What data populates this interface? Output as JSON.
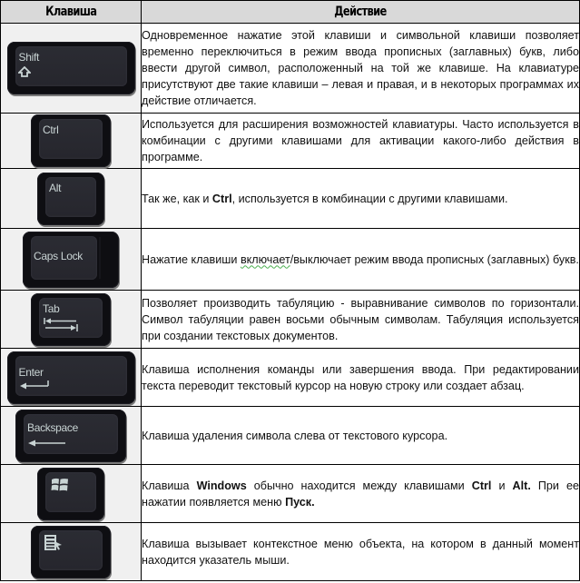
{
  "table": {
    "headers": {
      "key": "Клавиша",
      "action": "Действие"
    },
    "colors": {
      "header_bg": "#d9d9d9",
      "key_column_bg": "#f0f0f0",
      "keycap": "#0e0e12",
      "key_label": "#c9d4d4"
    },
    "rows": [
      {
        "key_label": "Shift",
        "key_icon": "shift-arrow-icon",
        "description": "Одновременное нажатие этой клавиши и символьной клавиши позволяет временно переключиться в режим ввода прописных (заглавных) букв, либо ввести другой символ, расположенный на той же клавише. На клавиатуре присутствуют две такие клавиши – левая и правая, и в некоторых программах их действие отличается."
      },
      {
        "key_label": "Ctrl",
        "description": "Используется для расширения возможностей клавиатуры. Часто используется в комбинации с другими клавишами для активации какого-либо действия в программе."
      },
      {
        "key_label": "Alt",
        "description_parts": [
          "Так же, как и ",
          "Ctrl",
          ", используется в комбинации с другими клавишами."
        ]
      },
      {
        "key_label": "Caps Lock",
        "description_parts": [
          "Нажатие клавиши ",
          "включает",
          "/выключает режим ввода прописных (заглавных) букв."
        ]
      },
      {
        "key_label": "Tab",
        "key_icon": "tab-arrows-icon",
        "description": "Позволяет производить табуляцию - выравнивание символов по горизонтали. Символ табуляции равен восьми обычным символам. Табуляция используется при создании текстовых документов."
      },
      {
        "key_label": "Enter",
        "key_icon": "enter-arrow-icon",
        "description": "Клавиша исполнения команды или завершения ввода. При редактировании текста переводит текстовый курсор на новую строку или создает абзац."
      },
      {
        "key_label": "Backspace",
        "key_icon": "backspace-arrow-icon",
        "description": "Клавиша удаления символа слева от текстового курсора."
      },
      {
        "key_label": "",
        "key_icon": "windows-logo-icon",
        "description_parts": [
          "Клавиша ",
          "Windows",
          " обычно находится между клавишами ",
          "Ctrl",
          " и ",
          "Alt.",
          " При ее нажатии появляется меню ",
          "Пуск."
        ]
      },
      {
        "key_label": "",
        "key_icon": "context-menu-icon",
        "description": "Клавиша вызывает контекстное меню объекта, на котором в данный момент находится указатель мыши."
      }
    ]
  }
}
